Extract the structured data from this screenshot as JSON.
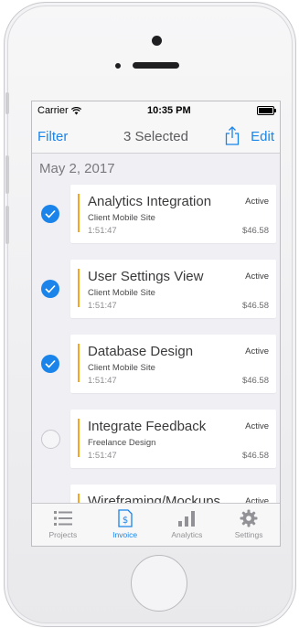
{
  "status_bar": {
    "carrier": "Carrier",
    "time": "10:35 PM"
  },
  "nav": {
    "left": "Filter",
    "title": "3 Selected",
    "right": "Edit"
  },
  "section": {
    "date": "May 2, 2017"
  },
  "items": [
    {
      "title": "Analytics Integration",
      "client": "Client Mobile Site",
      "duration": "1:51:47",
      "status": "Active",
      "amount": "$46.58",
      "selected": true
    },
    {
      "title": "User Settings View",
      "client": "Client Mobile Site",
      "duration": "1:51:47",
      "status": "Active",
      "amount": "$46.58",
      "selected": true
    },
    {
      "title": "Database Design",
      "client": "Client Mobile Site",
      "duration": "1:51:47",
      "status": "Active",
      "amount": "$46.58",
      "selected": true
    },
    {
      "title": "Integrate Feedback",
      "client": "Freelance Design",
      "duration": "1:51:47",
      "status": "Active",
      "amount": "$46.58",
      "selected": false
    },
    {
      "title": "Wireframing/Mockups",
      "status": "Active"
    }
  ],
  "tabs": [
    {
      "label": "Projects",
      "icon": "list-icon",
      "active": false
    },
    {
      "label": "Invoice",
      "icon": "invoice-icon",
      "active": true
    },
    {
      "label": "Analytics",
      "icon": "bar-chart-icon",
      "active": false
    },
    {
      "label": "Settings",
      "icon": "gear-icon",
      "active": false
    }
  ],
  "colors": {
    "accent": "#1a84ea",
    "bar": "#f5a623"
  }
}
